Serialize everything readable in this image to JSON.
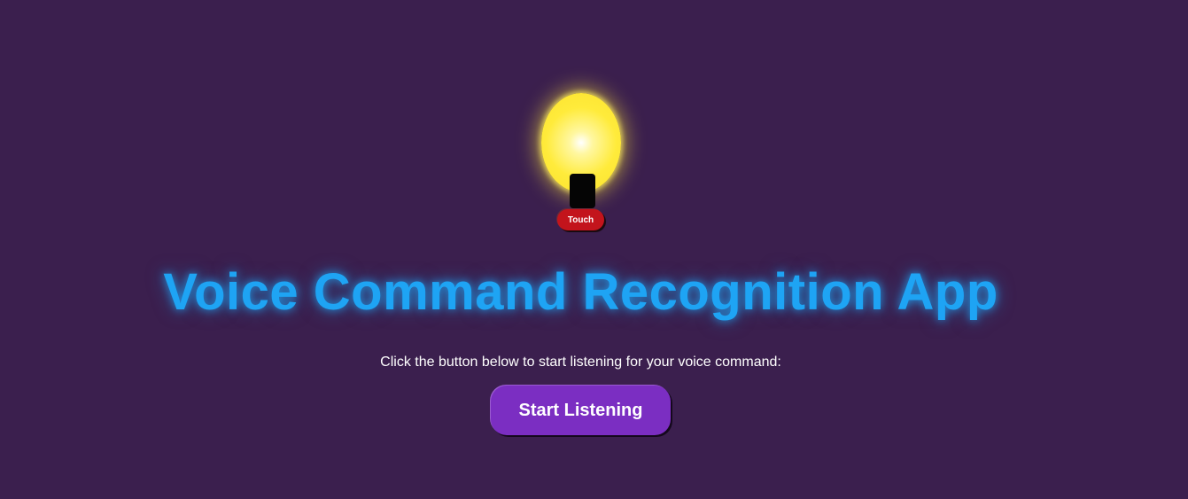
{
  "bulb": {
    "touch_label": "Touch",
    "glow_color": "#ffeb3b"
  },
  "header": {
    "title": "Voice Command Recognition App"
  },
  "main": {
    "instruction": "Click the button below to start listening for your voice command:",
    "start_label": "Start Listening"
  },
  "colors": {
    "background": "#3b1f4e",
    "title": "#1ea4f4",
    "start_button": "#7b2ec2",
    "touch_button": "#c3141c"
  }
}
